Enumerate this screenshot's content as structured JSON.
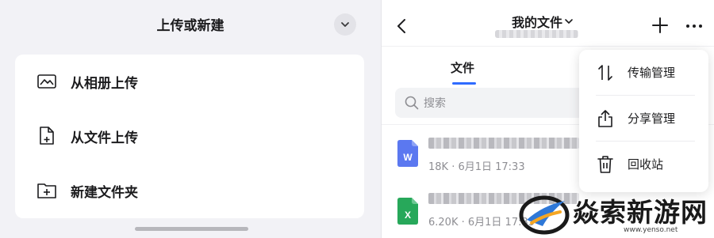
{
  "upload_sheet": {
    "title": "上传或新建",
    "options": [
      {
        "label": "从相册上传",
        "icon": "image-icon"
      },
      {
        "label": "从文件上传",
        "icon": "file-add-icon"
      },
      {
        "label": "新建文件夹",
        "icon": "folder-add-icon"
      }
    ]
  },
  "file_browser": {
    "title": "我的文件",
    "tabs": [
      {
        "label": "文件",
        "active": true
      }
    ],
    "search": {
      "placeholder": "搜索"
    },
    "files": [
      {
        "type": "word",
        "icon_letter": "W",
        "color": "#5b78f0",
        "meta": "18K · 6月1日 17:33"
      },
      {
        "type": "excel",
        "icon_letter": "X",
        "color": "#27a85a",
        "meta": "6.20K · 6月1日 17:35"
      }
    ],
    "menu": [
      {
        "label": "传输管理",
        "icon": "transfer-icon"
      },
      {
        "label": "分享管理",
        "icon": "share-icon"
      },
      {
        "label": "回收站",
        "icon": "trash-icon"
      }
    ]
  },
  "watermark": {
    "text": "焱索新游网",
    "url": "www.yenso.net"
  },
  "colors": {
    "accent": "#2f6bff",
    "sheet_bg": "#f2f2f6",
    "word": "#5b78f0",
    "excel": "#27a85a"
  }
}
